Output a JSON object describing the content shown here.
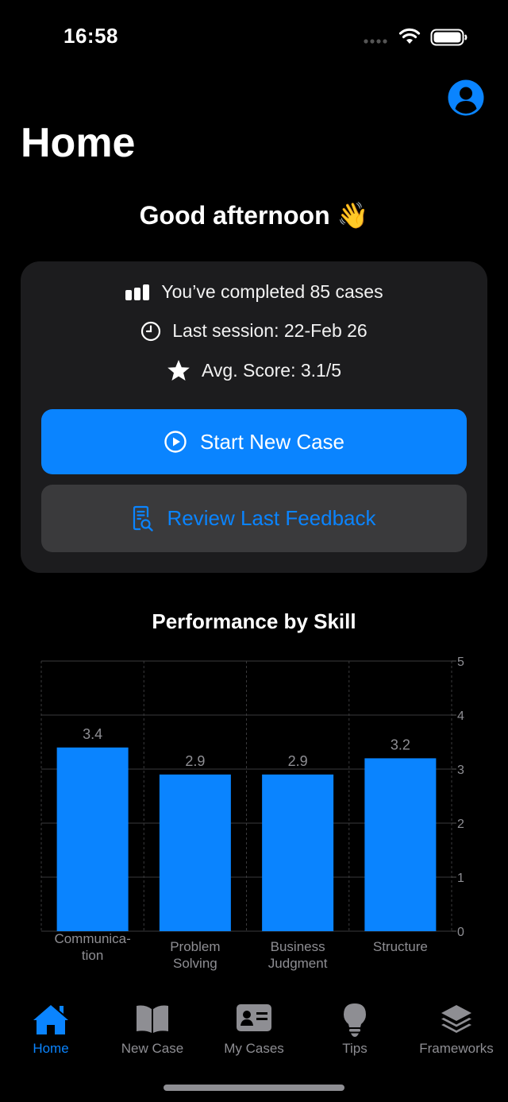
{
  "status_bar": {
    "time": "16:58"
  },
  "header": {
    "title": "Home",
    "profile_icon": "person-circle-icon"
  },
  "greeting": {
    "text": "Good afternoon",
    "emoji": "👋"
  },
  "summary": {
    "completed_cases": "You’ve completed 85 cases",
    "last_session": "Last session: 22-Feb 26",
    "avg_score": "Avg. Score: 3.1/5",
    "start_button": "Start New Case",
    "review_button": "Review Last Feedback"
  },
  "colors": {
    "accent": "#0a84ff",
    "card": "#1c1c1e",
    "secondary_button": "#3a3a3c",
    "inactive": "#8e8e93"
  },
  "chart_title": "Performance by Skill",
  "chart_data": {
    "type": "bar",
    "categories": [
      [
        "Communica-",
        "tion"
      ],
      [
        "Problem",
        "Solving"
      ],
      [
        "Business",
        "Judgment"
      ],
      [
        "Structure"
      ]
    ],
    "values": [
      3.4,
      2.9,
      2.9,
      3.2
    ],
    "value_labels": [
      "3.4",
      "2.9",
      "2.9",
      "3.2"
    ],
    "ylim": [
      0,
      5
    ],
    "yticks": [
      "0",
      "1",
      "2",
      "3",
      "4",
      "5"
    ],
    "grid": true,
    "y_axis_side": "right"
  },
  "tabs": [
    {
      "label": "Home",
      "icon": "house-icon",
      "active": true
    },
    {
      "label": "New Case",
      "icon": "book-icon",
      "active": false
    },
    {
      "label": "My Cases",
      "icon": "contact-card-icon",
      "active": false
    },
    {
      "label": "Tips",
      "icon": "lightbulb-icon",
      "active": false
    },
    {
      "label": "Frameworks",
      "icon": "layers-icon",
      "active": false
    }
  ]
}
